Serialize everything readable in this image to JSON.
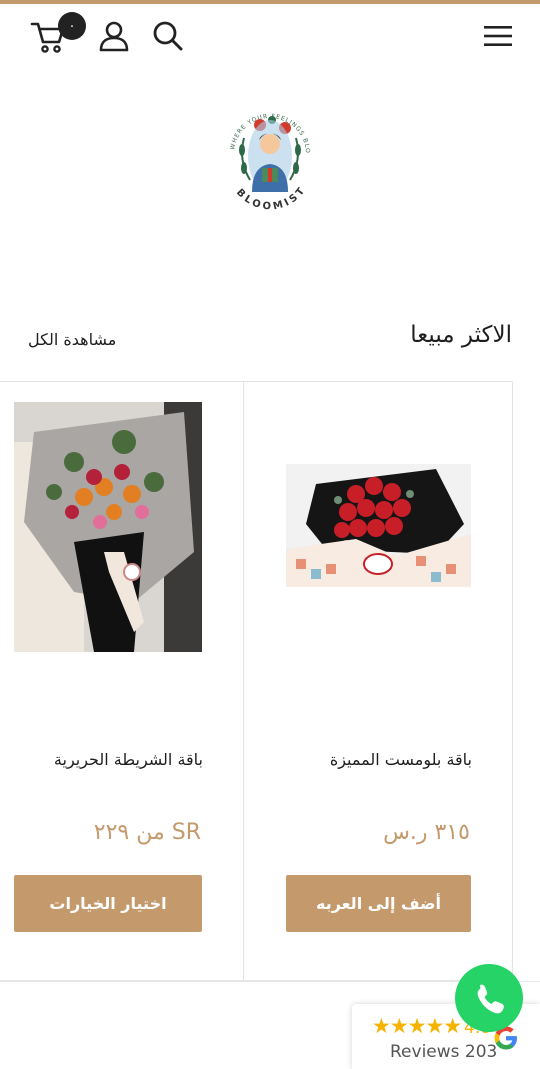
{
  "header": {
    "cart_count": "٠",
    "menu_icon": "hamburger-menu-icon",
    "search_icon": "search-icon",
    "account_icon": "user-icon",
    "cart_icon": "cart-icon"
  },
  "logo": {
    "brand": "BLOOMIST",
    "tagline": "WHERE YOUR FEELINGS BLOOM"
  },
  "section": {
    "title": "الاكثر مبيعا",
    "view_all": "مشاهدة الكل"
  },
  "products": [
    {
      "name": "باقة بلومست المميزة",
      "price": "٣١٥ ر.س",
      "button": "أضف إلى العربه"
    },
    {
      "name": "باقة الشريطة الحريرية",
      "price": "من ٢٢٩ SR",
      "button": "اختيار الخيارات"
    }
  ],
  "reviews": {
    "stars": "★★★★★",
    "rating": "4.8",
    "count_label": "Reviews 203"
  },
  "colors": {
    "accent": "#c49a6c",
    "whatsapp": "#25d366"
  }
}
